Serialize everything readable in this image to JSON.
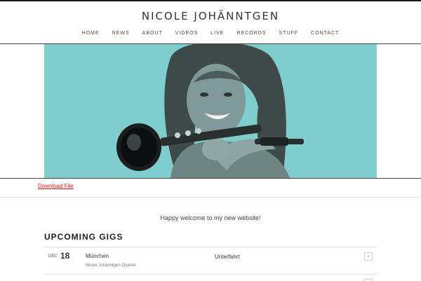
{
  "header": {
    "site_title": "NICOLE JOHÄNNTGEN",
    "nav": [
      "HOME",
      "NEWS",
      "ABOUT",
      "VIDEOS",
      "LIVE",
      "RECORDS",
      "STUFF",
      "CONTACT"
    ]
  },
  "hero": {
    "description_icon": "photo-of-woman-with-clarinet-icon",
    "background_color": "#7fcdcc"
  },
  "links": {
    "download": "Download File"
  },
  "welcome": {
    "text": "Happy welcome to my new website!"
  },
  "gigs": {
    "title": "UPCOMING GIGS",
    "items": [
      {
        "month": "DEC",
        "day": "18",
        "city": "München",
        "band": "Nicole Johänntgen Quartet",
        "venue": "Unterfahrt",
        "toggle": "+"
      }
    ]
  }
}
